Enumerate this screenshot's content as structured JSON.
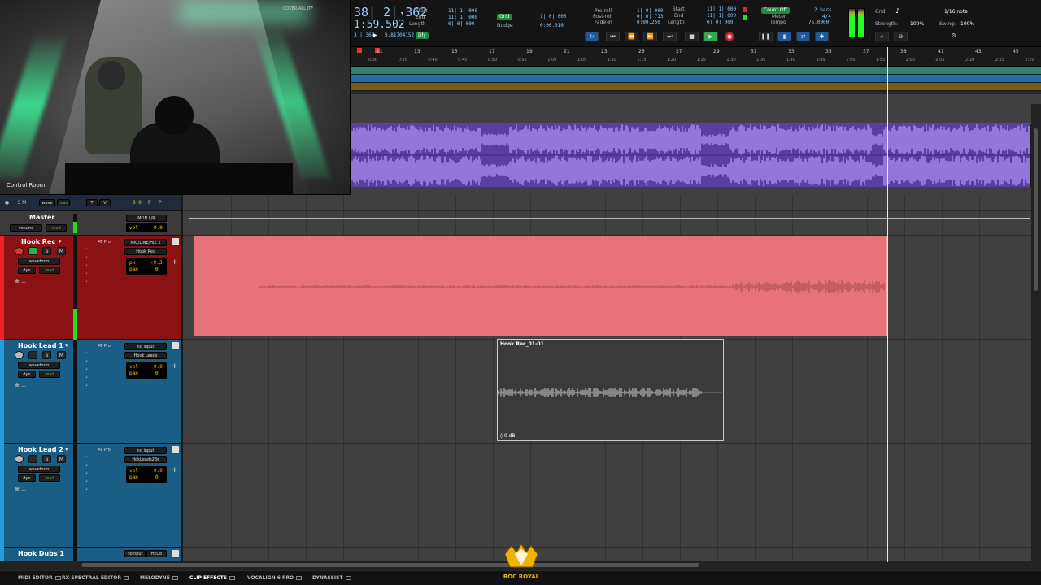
{
  "webcam": {
    "caption": "Control Room",
    "corner_text": "COVER ALL JTF"
  },
  "transport": {
    "main_counter": "38| 2| 362",
    "sub_counter": "1:59.502",
    "mini_counter": "3 | 367",
    "mini_value": "0.81704152",
    "mini_badge": "Dly",
    "selection": {
      "start_label": "Start",
      "end_label": "End",
      "length_label": "Length",
      "start_value": "11| 1| 000",
      "end_value": "11| 1| 000",
      "length_value": "0| 0| 000"
    },
    "grid_label": "Grid",
    "grid_value": "1| 0| 000",
    "nudge_label": "Nudge",
    "nudge_value": "0:00.010",
    "preroll_label": "Pre-roll",
    "postroll_label": "Post-roll",
    "fadein_label": "Fade-in",
    "preroll_value": "1| 0| 000",
    "postroll_value": "0| 0| 713",
    "fadein_value": "0:00.250",
    "start2_label": "Start",
    "end2_label": "End",
    "length2_label": "Length",
    "start2_value": "11| 1| 000",
    "end2_value": "11| 1| 000",
    "length2_value": "0| 0| 000",
    "countoff_label": "Count Off",
    "countoff_value": "2 bars",
    "meter_label": "Meter",
    "meter_value": "4/4",
    "tempo_label": "Tempo",
    "tempo_value": "75.0000",
    "grid_right_label": "Grid:",
    "grid_right_value": "1/16 note",
    "strength_label": "Strength:",
    "strength_value": "100%",
    "swing_label": "Swing:",
    "swing_value": "100%"
  },
  "ruler": {
    "bars": [
      "11",
      "13",
      "15",
      "17",
      "19",
      "21",
      "23",
      "25",
      "27",
      "29",
      "31",
      "33",
      "35",
      "37",
      "38",
      "41",
      "43",
      "45"
    ],
    "times": [
      "0:30",
      "0:35",
      "0:40",
      "0:45",
      "0:50",
      "0:55",
      "1:00",
      "1:05",
      "1:10",
      "1:15",
      "1:20",
      "1:25",
      "1:30",
      "1:35",
      "1:40",
      "1:45",
      "1:50",
      "1:55",
      "2:00",
      "2:05",
      "2:10",
      "2:15",
      "2:20"
    ]
  },
  "tracks": [
    {
      "name": "Master",
      "auto_mode": "volume",
      "auto_read": "read",
      "io_out": "MON L/R",
      "vol_label": "vol",
      "vol_value": "0.0"
    },
    {
      "name": "Hook Rec",
      "auto_mode": "waveform",
      "plugin": "dyn",
      "read": "read",
      "insert": "AT Pro",
      "io_in": "MIC/LINE/HIZ 2",
      "io_out": "Hook Rec",
      "vol_label": "pk",
      "vol_value": "-9.3",
      "pan_label": "pan",
      "pan_value": "0",
      "color": "#c8151b"
    },
    {
      "name": "Hook Lead 1",
      "auto_mode": "waveform",
      "plugin": "dyn",
      "read": "read",
      "insert": "AT Pro",
      "io_in": "no input",
      "io_out": "Hook Leads",
      "vol_label": "vol",
      "vol_value": "0.0",
      "pan_label": "pan",
      "pan_value": "0",
      "color": "#1f8fc9"
    },
    {
      "name": "Hook Lead 2",
      "auto_mode": "waveform",
      "plugin": "dyn",
      "read": "read",
      "insert": "AT Pro",
      "io_in": "no input",
      "io_out": "HokLeads28s",
      "vol_label": "vol",
      "vol_value": "0.0",
      "pan_label": "pan",
      "pan_value": "0",
      "color": "#1f8fc9"
    },
    {
      "name": "Hook Dubs 1",
      "io_in": "noinput",
      "io_out": "HkDb"
    }
  ],
  "top_strip": {
    "mode": "wave",
    "read": "read",
    "values": "0.0",
    "p1": "P",
    "p2": "P"
  },
  "clips": {
    "hook_lead_clip": {
      "name": "Hook Rec_01-01",
      "gain": "0 dB"
    }
  },
  "plugins": [
    "MIDI EDITOR",
    "RX SPECTRAL EDITOR",
    "MELODYNE",
    "CLIP EFFECTS",
    "VOCALIGN 6 PRO",
    "DYNASSIST"
  ],
  "logo_text": "ROC ROYAL",
  "colors": {
    "accent_green": "#2ea84b",
    "record_red": "#d22222",
    "hookrec_clip": "#e8727a",
    "ref_clip": "#5a3ea0",
    "counter_blue": "#8fd0ff"
  }
}
